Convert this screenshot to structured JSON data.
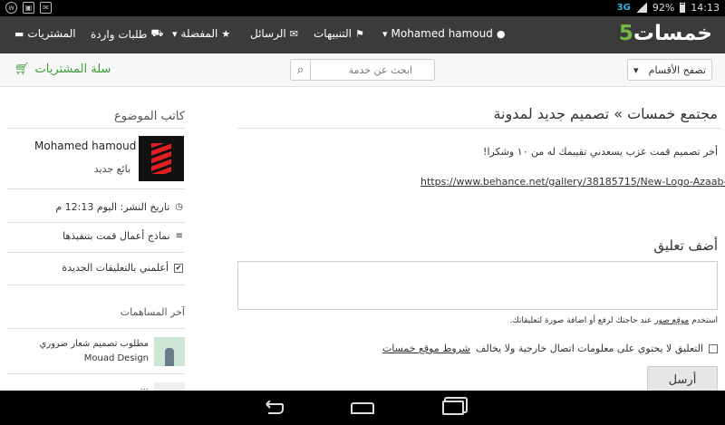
{
  "status_bar": {
    "network": "3G",
    "battery": "92%",
    "time": "14:13"
  },
  "header": {
    "logo_text": "خمسات",
    "logo_digit": "5",
    "nav": {
      "user": "Mohamed hamoud",
      "notifications": "التنبيهات",
      "messages": "الرسائل",
      "favorites": "المفضلة",
      "incoming_orders": "طلبات واردة",
      "purchases": "المشتريات"
    }
  },
  "toolbar": {
    "cart_label": "سلة المشتريات",
    "search_placeholder": "ابحث عن خدمة",
    "browse_label": "تصفح الأقسام"
  },
  "sidebar": {
    "author_heading": "كاتب الموضوع",
    "author_name": "Mohamed hamoud",
    "author_role": "بائع جديد",
    "published": "تاريخ النشر: اليوم 12:13 م",
    "portfolio": "نماذج أعمال قمت بتنفيذها",
    "notify_label": "أعلمني بالتعليقات الجديدة",
    "contributions_heading": "آخر المساهمات",
    "contributions": [
      {
        "title": "مطلوب تصميم شعار ضروري",
        "author": "Mouad Design"
      },
      {
        "title": "...",
        "author": ""
      }
    ]
  },
  "main": {
    "breadcrumb_title": "مجتمع خمسات » تصميم جديد لمدونة",
    "post_text": "أخر تصميم قمت عزب يسعدني تقييمك له من ١٠ وشكرا!",
    "post_link": "https://www.behance.net/gallery/38185715/New-Logo-Azaab-Blog",
    "comment_heading": "أضف تعليق",
    "comment_value": "",
    "hint_prefix": "استخدم",
    "hint_link": "موقع صور",
    "hint_suffix": "عند حاجتك لرفع أو اضافة صورة لتعليقاتك.",
    "terms_text": "التعليق لا يحتوي على معلومات اتصال خارجية ولا يخالف",
    "terms_link": "شروط موقع خمسات",
    "send_label": "أرسل"
  },
  "colors": {
    "brand_green": "#75b843",
    "cart_green": "#3e9c35",
    "nav_bg": "#3b3b3b",
    "accent_blue": "#33b5e5"
  }
}
